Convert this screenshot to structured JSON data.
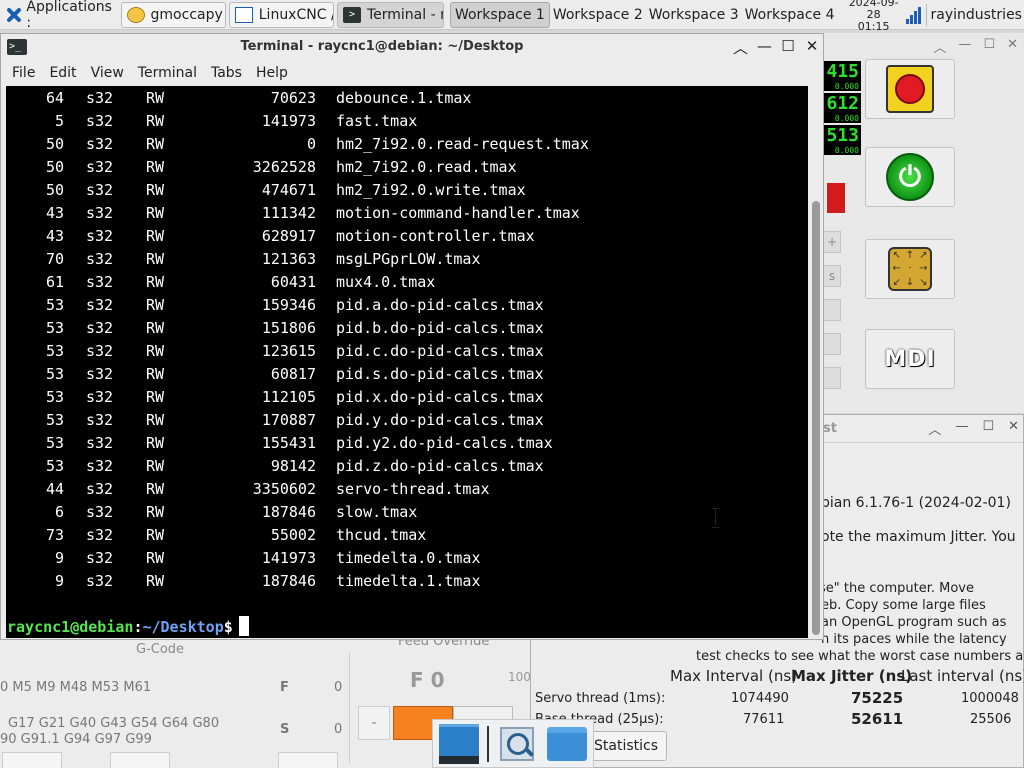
{
  "taskbar": {
    "applications_label": "Applications :",
    "tasks": [
      {
        "label": "gmoccapy f...",
        "icon": "gmoccapy-icon"
      },
      {
        "label": "LinuxCNC / ...",
        "icon": "window-icon"
      },
      {
        "label": "Terminal - r...",
        "icon": "terminal-icon",
        "active": true
      }
    ],
    "workspaces": [
      "Workspace 1",
      "Workspace 2",
      "Workspace 3",
      "Workspace 4"
    ],
    "active_workspace": 0,
    "clock_date": "2024-09-28",
    "clock_time": "01:15",
    "user": "rayindustries"
  },
  "terminal": {
    "title": "Terminal - raycnc1@debian: ~/Desktop",
    "menu": [
      "File",
      "Edit",
      "View",
      "Terminal",
      "Tabs",
      "Help"
    ],
    "rows": [
      {
        "owner": "64",
        "type": "s32",
        "dir": "RW",
        "value": "70623",
        "name": "debounce.1.tmax"
      },
      {
        "owner": "5",
        "type": "s32",
        "dir": "RW",
        "value": "141973",
        "name": "fast.tmax"
      },
      {
        "owner": "50",
        "type": "s32",
        "dir": "RW",
        "value": "0",
        "name": "hm2_7i92.0.read-request.tmax"
      },
      {
        "owner": "50",
        "type": "s32",
        "dir": "RW",
        "value": "3262528",
        "name": "hm2_7i92.0.read.tmax"
      },
      {
        "owner": "50",
        "type": "s32",
        "dir": "RW",
        "value": "474671",
        "name": "hm2_7i92.0.write.tmax"
      },
      {
        "owner": "43",
        "type": "s32",
        "dir": "RW",
        "value": "111342",
        "name": "motion-command-handler.tmax"
      },
      {
        "owner": "43",
        "type": "s32",
        "dir": "RW",
        "value": "628917",
        "name": "motion-controller.tmax"
      },
      {
        "owner": "70",
        "type": "s32",
        "dir": "RW",
        "value": "121363",
        "name": "msgLPGprLOW.tmax"
      },
      {
        "owner": "61",
        "type": "s32",
        "dir": "RW",
        "value": "60431",
        "name": "mux4.0.tmax"
      },
      {
        "owner": "53",
        "type": "s32",
        "dir": "RW",
        "value": "159346",
        "name": "pid.a.do-pid-calcs.tmax"
      },
      {
        "owner": "53",
        "type": "s32",
        "dir": "RW",
        "value": "151806",
        "name": "pid.b.do-pid-calcs.tmax"
      },
      {
        "owner": "53",
        "type": "s32",
        "dir": "RW",
        "value": "123615",
        "name": "pid.c.do-pid-calcs.tmax"
      },
      {
        "owner": "53",
        "type": "s32",
        "dir": "RW",
        "value": "60817",
        "name": "pid.s.do-pid-calcs.tmax"
      },
      {
        "owner": "53",
        "type": "s32",
        "dir": "RW",
        "value": "112105",
        "name": "pid.x.do-pid-calcs.tmax"
      },
      {
        "owner": "53",
        "type": "s32",
        "dir": "RW",
        "value": "170887",
        "name": "pid.y.do-pid-calcs.tmax"
      },
      {
        "owner": "53",
        "type": "s32",
        "dir": "RW",
        "value": "155431",
        "name": "pid.y2.do-pid-calcs.tmax"
      },
      {
        "owner": "53",
        "type": "s32",
        "dir": "RW",
        "value": "98142",
        "name": "pid.z.do-pid-calcs.tmax"
      },
      {
        "owner": "44",
        "type": "s32",
        "dir": "RW",
        "value": "3350602",
        "name": "servo-thread.tmax"
      },
      {
        "owner": "6",
        "type": "s32",
        "dir": "RW",
        "value": "187846",
        "name": "slow.tmax"
      },
      {
        "owner": "73",
        "type": "s32",
        "dir": "RW",
        "value": "55002",
        "name": "thcud.tmax"
      },
      {
        "owner": "9",
        "type": "s32",
        "dir": "RW",
        "value": "141973",
        "name": "timedelta.0.tmax"
      },
      {
        "owner": "9",
        "type": "s32",
        "dir": "RW",
        "value": "187846",
        "name": "timedelta.1.tmax"
      }
    ],
    "prompt_user": "raycnc1@debian",
    "prompt_sep": ":",
    "prompt_path": "~/Desktop",
    "prompt_symbol": "$"
  },
  "gmoccapy": {
    "dro_values": [
      "415",
      "612",
      "513"
    ],
    "dro_sub": [
      "0.000",
      "0.000",
      "0.000"
    ],
    "side_buttons": [
      "+",
      "s"
    ],
    "mdi_label": "MDI",
    "gcode_title": "G-Code",
    "feed_title": "Feed Override",
    "gcode_line1": "0 M5 M9 M48 M53 M61",
    "gcode_line2": "G17 G21 G40 G43 G54 G64 G80",
    "gcode_line3": "90 G91.1 G94 G97 G99",
    "f_label": "F",
    "f_value": "0",
    "s_label": "S",
    "s_value": "0",
    "feed_display": "F 0",
    "feed_percent": "100",
    "minus_label": "-"
  },
  "latency": {
    "title_fragment": "st",
    "kernel_line": "bian 6.1.76-1 (2024-02-01)",
    "note_line": "ote the maximum Jitter. You",
    "para1": "se\" the computer. Move",
    "para2": "eb. Copy some large files",
    "para3": "an OpenGL program such as",
    "para4": "h its paces while the latency",
    "para5": "test checks to see what the worst case numbers are.",
    "col_max_interval": "Max Interval (ns)",
    "col_max_jitter": "Max Jitter (ns)",
    "col_last_interval": "Last interval (ns)",
    "servo_label": "Servo thread (1ms):",
    "servo_max_interval": "1074490",
    "servo_max_jitter": "75225",
    "servo_last_interval": "1000048",
    "base_label": "Base thread (25µs):",
    "base_max_interval": "77611",
    "base_max_jitter": "52611",
    "base_last_interval": "25506",
    "statistics_button": "Statistics"
  }
}
